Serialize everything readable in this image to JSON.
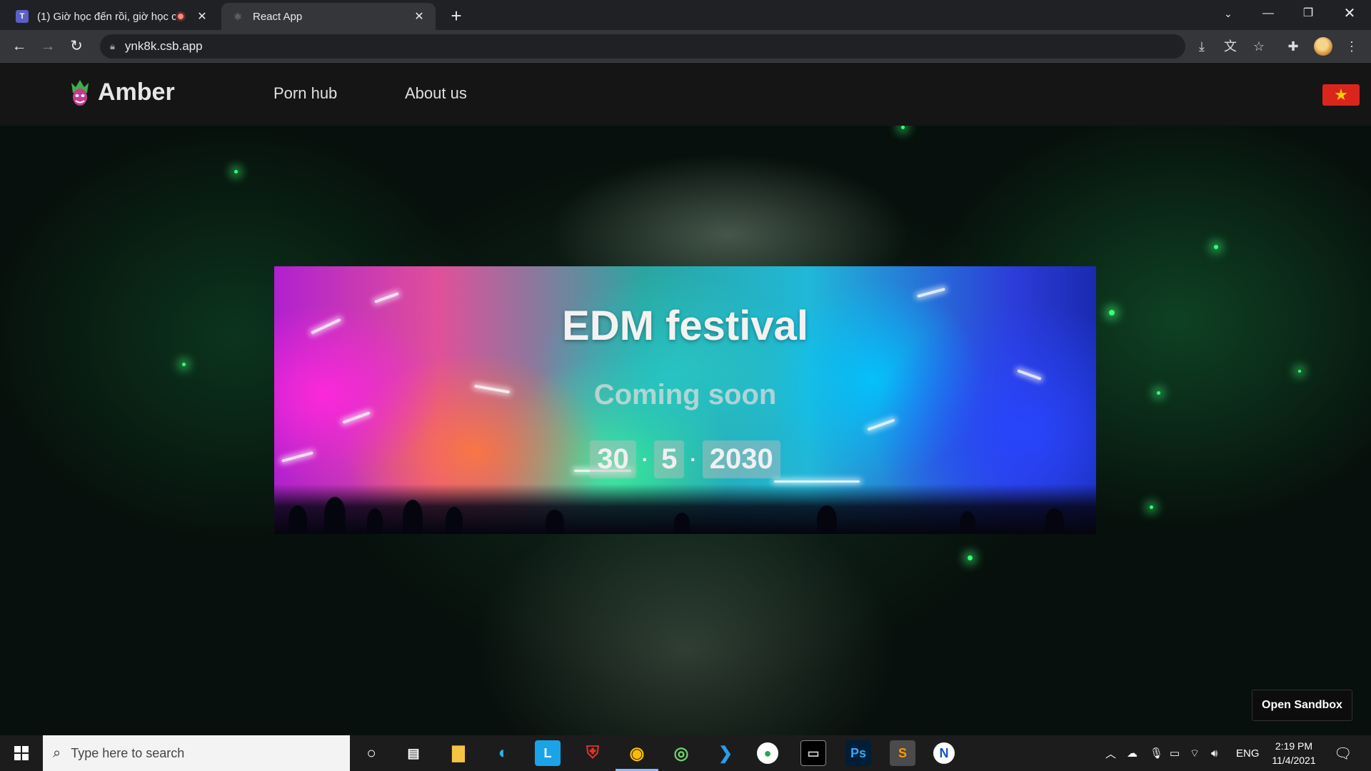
{
  "browser": {
    "tabs": [
      {
        "title": "(1) Giờ học đến rồi, giờ học c",
        "favicon": "teams-icon"
      },
      {
        "title": "React App",
        "favicon": "react-icon"
      }
    ],
    "url": "ynk8k.csb.app"
  },
  "site": {
    "brand": "Amber",
    "nav": [
      "Porn hub",
      "About us"
    ],
    "flag": "vietnam-flag"
  },
  "banner": {
    "title": "EDM festival",
    "subtitle": "Coming soon",
    "date": {
      "day": "30",
      "month": "5",
      "year": "2030"
    }
  },
  "open_sandbox": "Open Sandbox",
  "taskbar": {
    "search_placeholder": "Type here to search",
    "language": "ENG",
    "time": "2:19 PM",
    "date": "11/4/2021"
  },
  "colors": {
    "tabbar": "#202124",
    "toolbar": "#35363a",
    "navbar": "#151515",
    "accent_green": "#36ff7a"
  }
}
